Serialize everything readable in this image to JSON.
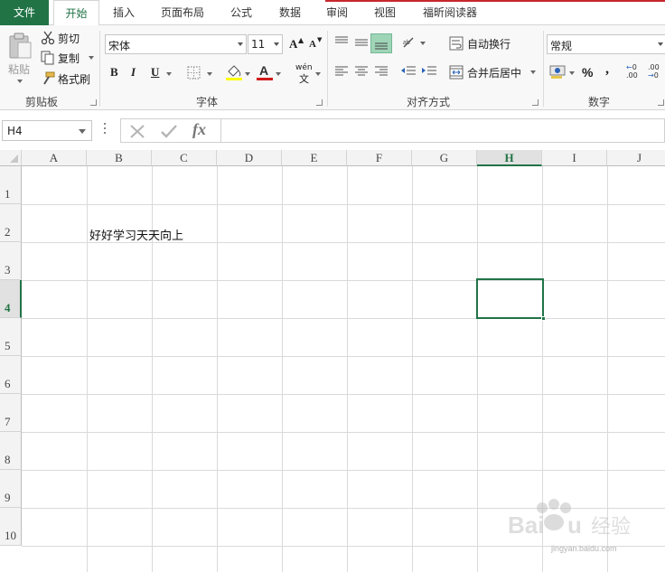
{
  "colors": {
    "accent": "#217346",
    "red_strip": "#c8262c"
  },
  "tabs": [
    "文件",
    "开始",
    "插入",
    "页面布局",
    "公式",
    "数据",
    "审阅",
    "视图",
    "福昕阅读器"
  ],
  "active_tab": "开始",
  "clipboard": {
    "paste": "粘贴",
    "cut": "剪切",
    "copy": "复制",
    "format_painter": "格式刷",
    "label": "剪贴板"
  },
  "font": {
    "name": "宋体",
    "size": "11",
    "bold": "B",
    "italic": "I",
    "underline": "U",
    "phonetic_top": "wén",
    "phonetic_bottom": "文",
    "label": "字体"
  },
  "alignment": {
    "wrap_text": "自动换行",
    "merge_center": "合并后居中",
    "label": "对齐方式"
  },
  "number": {
    "format": "常规",
    "percent": "%",
    "comma": ",",
    "inc_decimal": "←0 .00",
    "dec_decimal": ".00 →0",
    "label": "数字"
  },
  "formula_bar": {
    "name_box": "H4",
    "fx": "fx",
    "value": ""
  },
  "columns": [
    "A",
    "B",
    "C",
    "D",
    "E",
    "F",
    "G",
    "H",
    "I",
    "J"
  ],
  "rows": [
    "1",
    "2",
    "3",
    "4",
    "5",
    "6",
    "7",
    "8",
    "9",
    "10"
  ],
  "selected_cell": "H4",
  "cells": {
    "B2": "好好学习天天向上"
  },
  "watermark": {
    "logo": "Baidu经验",
    "url": "jingyan.baidu.com"
  }
}
